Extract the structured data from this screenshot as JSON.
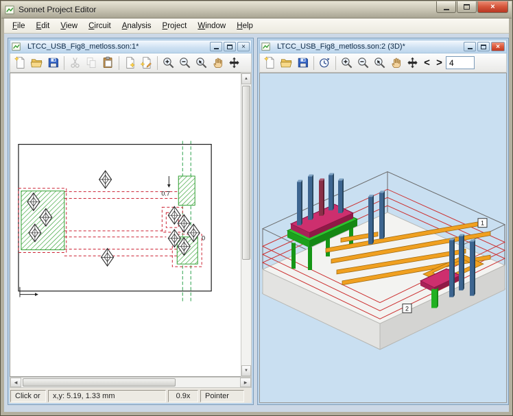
{
  "window": {
    "title": "Sonnet Project Editor",
    "close_glyph": "×"
  },
  "menu": {
    "items": [
      "File",
      "Edit",
      "View",
      "Circuit",
      "Analysis",
      "Project",
      "Window",
      "Help"
    ]
  },
  "scrollbar": {
    "up": "▲",
    "down": "▼",
    "left": "◀",
    "right": "▶"
  },
  "left_window": {
    "title": "LTCC_USB_Fig8_metloss.son:1*",
    "close_glyph": "×",
    "toolbar_icons": [
      "new-icon",
      "open-icon",
      "save-icon",
      "cut-icon",
      "copy-icon",
      "paste-icon",
      "add-component-icon",
      "add-metalization-icon",
      "zoom-in-icon",
      "zoom-out-icon",
      "zoom-area-icon",
      "pan-icon",
      "move-icon"
    ],
    "canvas": {
      "dim_label": "0.7",
      "zero_label": "0"
    },
    "status": {
      "hint": "Click or",
      "coords": "x,y: 5.19, 1.33 mm",
      "zoom": "0.9x",
      "tool": "Pointer"
    }
  },
  "right_window": {
    "title": "LTCC_USB_Fig8_metloss.son:2 (3D)*",
    "close_glyph": "×",
    "toolbar_icons": [
      "new-icon",
      "open-icon",
      "save-icon",
      "rotate-view-icon",
      "zoom-in-icon",
      "zoom-out-icon",
      "zoom-area-icon",
      "pan-icon",
      "move-icon"
    ],
    "prev_label": "<",
    "next_label": ">",
    "level_value": "4",
    "canvas": {
      "label1": "1",
      "label2": "2"
    }
  }
}
